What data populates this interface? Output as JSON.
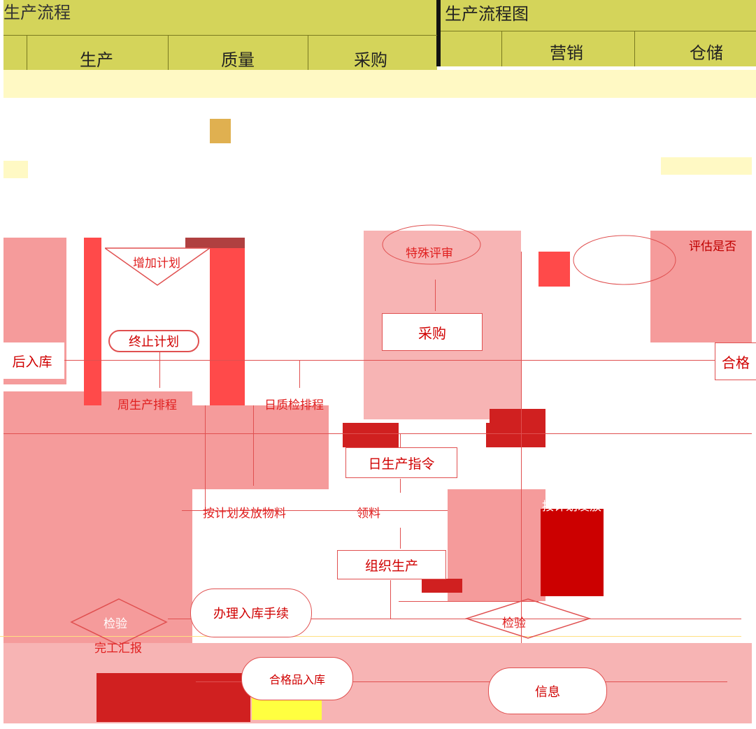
{
  "header": {
    "title_left": "生产流程",
    "title_right": "生产流程图",
    "lanes": [
      "生产",
      "质量",
      "采购",
      "营销",
      "仓储"
    ]
  },
  "nodes": {
    "plan_top": "增加计划",
    "terminate_plan": "终止计划",
    "stock_after": "后入库",
    "purchase": "采购",
    "special_approval": "特殊评审",
    "evaluate": "评估是否",
    "weekly_schedule": "周生产排程",
    "daily_qc_schedule": "日质检排程",
    "daily_order": "日生产指令",
    "issue_material": "按计划发放物料",
    "collect_material": "领料",
    "organize": "组织生产",
    "inspection": "检验",
    "finish_report": "完工汇报",
    "stock_in": "办理入库手续",
    "qualified": "合格",
    "qualified_product": "合格品入库",
    "plan_issue_right": "按计划发放",
    "information": "信息"
  },
  "colors": {
    "header": "#d4d45a",
    "pink": "#f59b9b",
    "red": "#ff4a4a",
    "dark_red": "#cc0000",
    "text_red": "#d00000"
  }
}
